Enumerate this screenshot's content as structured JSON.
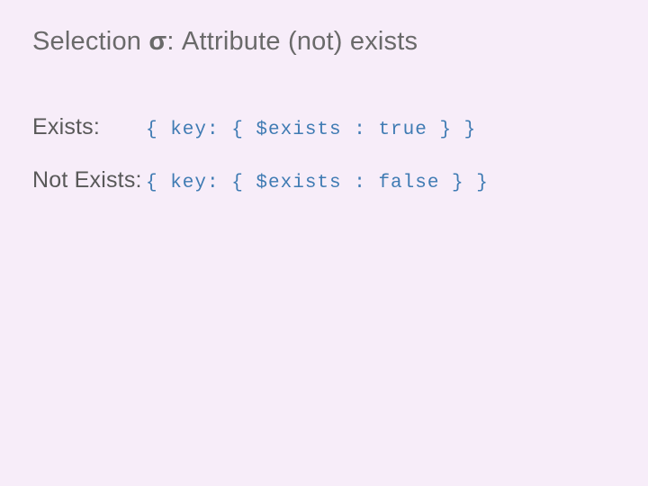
{
  "title": {
    "prefix": "Selection ",
    "sigma": "σ",
    "suffix": ": Attribute (not) exists"
  },
  "rows": [
    {
      "label": "Exists:",
      "code": "{ key: { $exists : true } }"
    },
    {
      "label": "Not Exists:",
      "code": "{ key: { $exists : false } }"
    }
  ]
}
